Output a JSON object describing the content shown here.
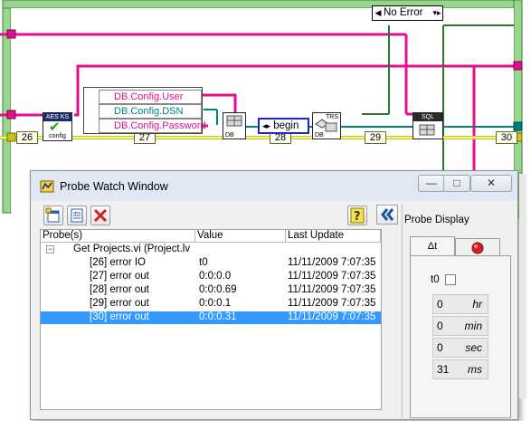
{
  "diagram": {
    "case_selector": {
      "value": "No Error"
    },
    "wire_numbers": [
      "26",
      "27",
      "28",
      "29",
      "30"
    ],
    "config_vi": {
      "header": "AES KS",
      "footer": "config"
    },
    "unbundle_fields": [
      "DB.Config.User",
      "DB.Config.DSN",
      "DB.Config.Password"
    ],
    "db_open_vi": {
      "label": "DB"
    },
    "begin_node": {
      "value": "begin"
    },
    "db_trs_vi": {
      "header": "TRS",
      "label": "DB"
    },
    "sql_vi": {
      "header": "SQL"
    }
  },
  "window": {
    "title": "Probe Watch Window",
    "buttons": {
      "minimize": "—",
      "maximize": "□",
      "close": "✕"
    }
  },
  "toolbar": {
    "icons": [
      "new-probe-icon",
      "add-probe-icon",
      "delete-probe-icon",
      "help-icon",
      "collapse-panel-icon"
    ]
  },
  "table": {
    "headers": [
      "Probe(s)",
      "Value",
      "Last Update"
    ],
    "group": {
      "label": "Get Projects.vi (Project.lv"
    },
    "rows": [
      {
        "probe": "[26] error IO",
        "value": "t0",
        "last_update": "11/11/2009 7:07:35",
        "selected": false
      },
      {
        "probe": "[27] error out",
        "value": "0:0:0.0",
        "last_update": "11/11/2009 7:07:35",
        "selected": false
      },
      {
        "probe": "[28] error out",
        "value": "0:0:0.69",
        "last_update": "11/11/2009 7:07:35",
        "selected": false
      },
      {
        "probe": "[29] error out",
        "value": "0:0:0.1",
        "last_update": "11/11/2009 7:07:35",
        "selected": false
      },
      {
        "probe": "[30] error out",
        "value": "0:0:0.31",
        "last_update": "11/11/2009 7:07:35",
        "selected": true
      }
    ]
  },
  "probe_display": {
    "label": "Probe Display",
    "tabs": {
      "delta_t": "Δt"
    },
    "t0_label": "t0",
    "time": {
      "hours": {
        "value": "0",
        "unit": "hr"
      },
      "minutes": {
        "value": "0",
        "unit": "min"
      },
      "seconds": {
        "value": "0",
        "unit": "sec"
      },
      "milliseconds": {
        "value": "31",
        "unit": "ms"
      }
    }
  },
  "colors": {
    "wire_error": "#c8c800",
    "wire_cluster": "#e30f8e",
    "wire_refnum": "#008080",
    "frame_green": "#3aa03a",
    "selection": "#3399ff"
  }
}
